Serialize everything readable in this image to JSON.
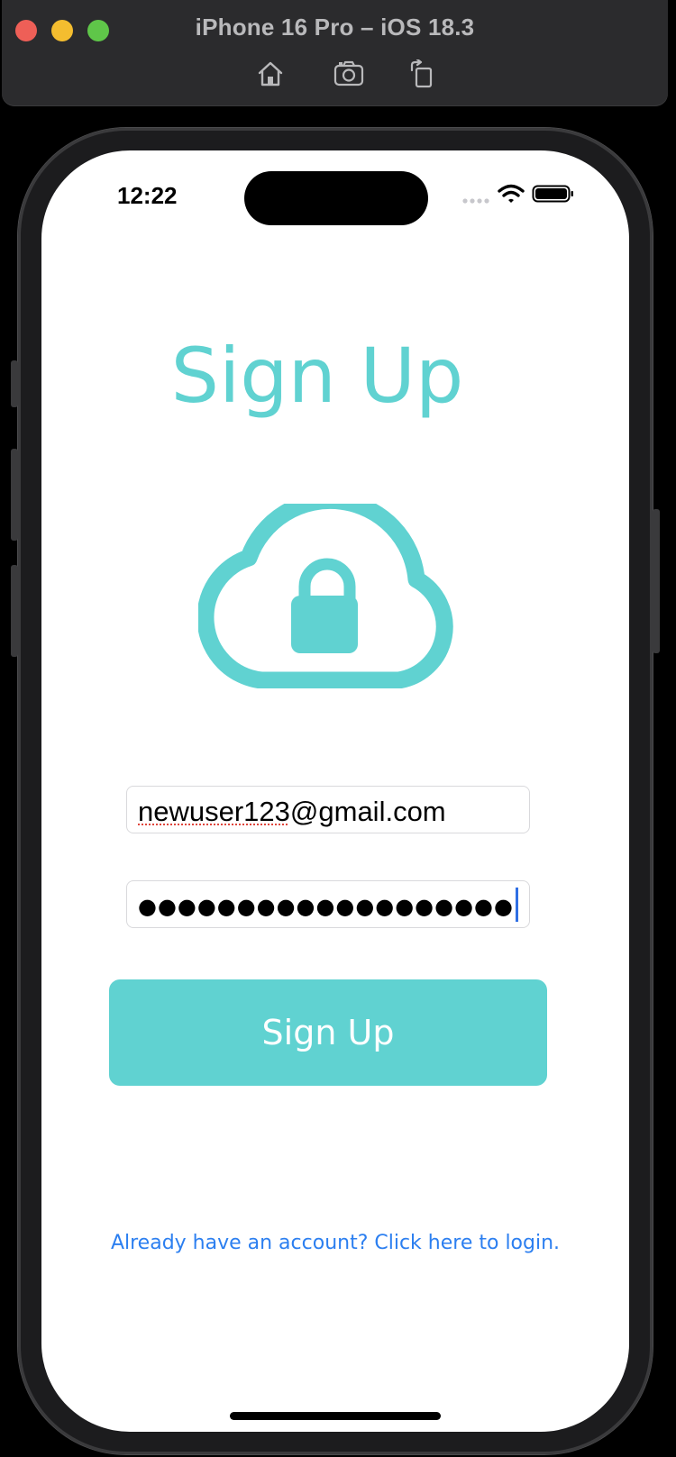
{
  "simulator": {
    "title": "iPhone 16 Pro – iOS 18.3",
    "toolbar": [
      "home-icon",
      "screenshot-icon",
      "rotate-icon"
    ]
  },
  "status_bar": {
    "time": "12:22",
    "icons": [
      "cellular-icon",
      "wifi-icon",
      "battery-icon"
    ]
  },
  "screen": {
    "title": "Sign Up",
    "hero_icon": "cloud-lock-icon",
    "email_value": "newuser123@gmail.com",
    "email_misspelled_part": "newuser123",
    "email_rest": "@gmail.com",
    "password_masked": "●●●●●●●●●●●●●●●●●●●",
    "password_length": 19,
    "signup_button_label": "Sign Up",
    "login_link": "Already have an account? Click here to login."
  },
  "colors": {
    "accent": "#60d2d1",
    "link": "#2c7ff0",
    "caret": "#2f6fe4",
    "spellcheck": "#e0463c"
  }
}
